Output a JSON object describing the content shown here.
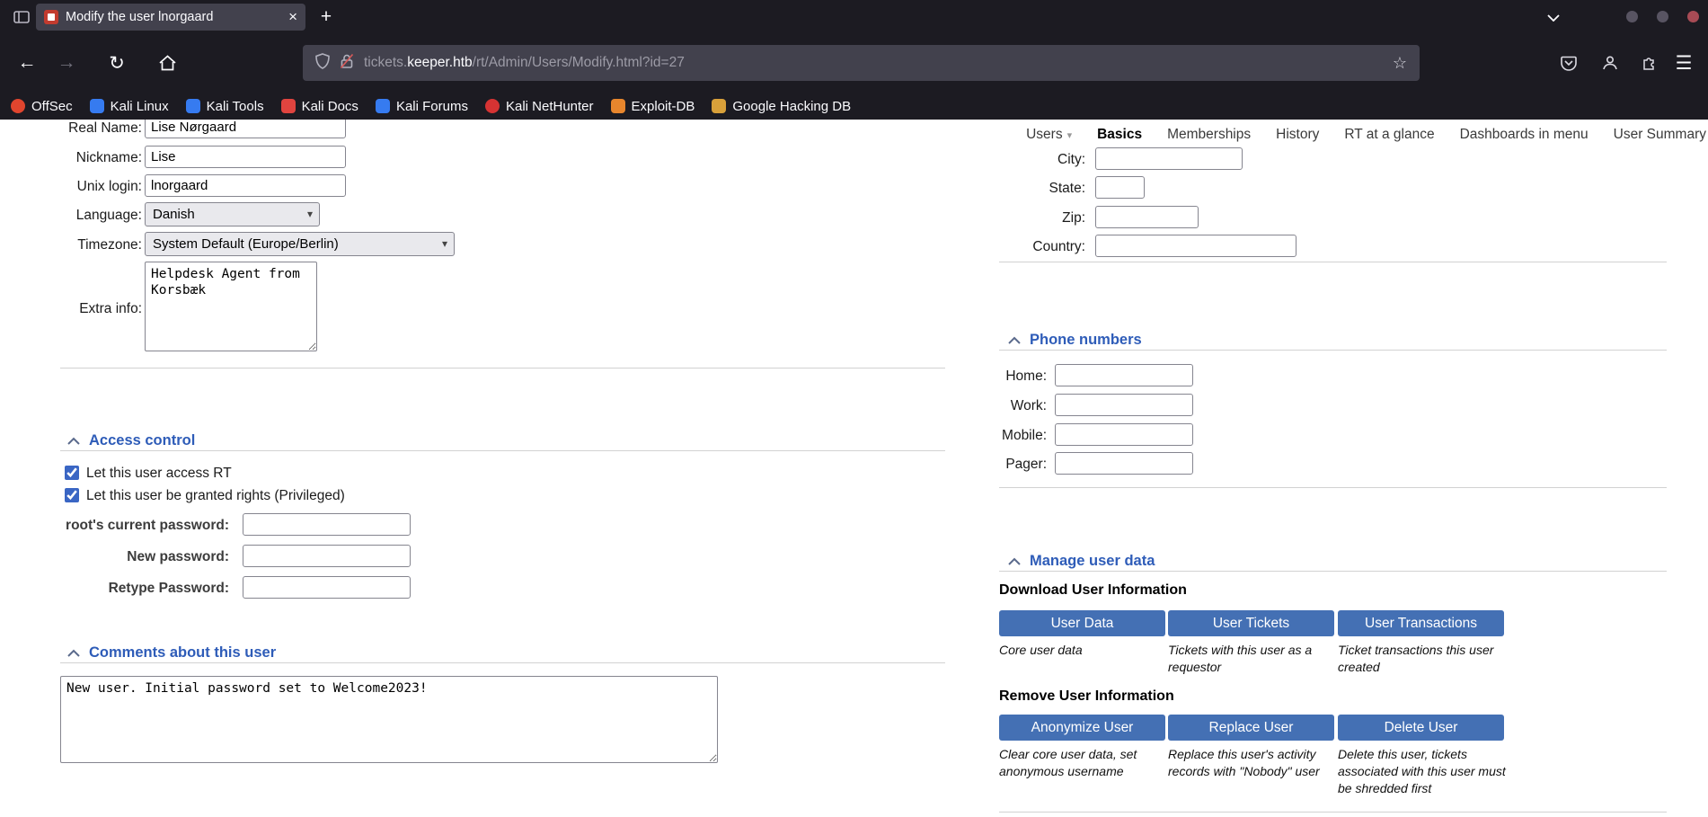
{
  "colors": {
    "chrome_bg": "#1c1b22",
    "tab_bg": "#42414d",
    "urlbar_bg": "#42414d",
    "chrome_text": "#fbfbfe",
    "page_bg": "#ffffff",
    "heading_blue": "#2e5cb8",
    "button_blue": "#4470b4",
    "button_text": "#ffffff",
    "checkbox_blue": "#3a66c4",
    "window_close_red": "#a84b55"
  },
  "browser": {
    "tab_title": "Modify the user lnorgaard",
    "tab_close_glyph": "×",
    "new_tab_glyph": "+",
    "back_glyph": "←",
    "forward_glyph": "→",
    "reload_glyph": "↻",
    "star_glyph": "☆",
    "menu_glyph": "☰",
    "url_prefix": "tickets.",
    "url_domain": "keeper.htb",
    "url_path": "/rt/Admin/Users/Modify.html?id=27",
    "bookmarks": [
      {
        "label": "OffSec",
        "color": "#e0452e"
      },
      {
        "label": "Kali Linux",
        "color": "#367bf0"
      },
      {
        "label": "Kali Tools",
        "color": "#367bf0"
      },
      {
        "label": "Kali Docs",
        "color": "#e0443f"
      },
      {
        "label": "Kali Forums",
        "color": "#367bf0"
      },
      {
        "label": "Kali NetHunter",
        "color": "#d63333"
      },
      {
        "label": "Exploit-DB",
        "color": "#e8862d"
      },
      {
        "label": "Google Hacking DB",
        "color": "#d8a03a"
      }
    ]
  },
  "page": {
    "menu": {
      "items": [
        {
          "label": "Users"
        },
        {
          "label": "Basics"
        },
        {
          "label": "Memberships"
        },
        {
          "label": "History"
        },
        {
          "label": "RT at a glance"
        },
        {
          "label": "Dashboards in menu"
        },
        {
          "label": "User Summary"
        }
      ],
      "users_caret": "▾"
    },
    "identity": {
      "real_name": {
        "label": "Real Name:",
        "value": "Lise Nørgaard"
      },
      "nickname": {
        "label": "Nickname:",
        "value": "Lise"
      },
      "unix_login": {
        "label": "Unix login:",
        "value": "lnorgaard"
      },
      "language": {
        "label": "Language:",
        "value": "Danish"
      },
      "timezone": {
        "label": "Timezone:",
        "value": "System Default (Europe/Berlin)"
      },
      "extra_info": {
        "label": "Extra info:",
        "value": "Helpdesk Agent from Korsbæk"
      }
    },
    "access_control": {
      "title": "Access control",
      "checkbox_access": "Let this user access RT",
      "checkbox_privileged": "Let this user be granted rights (Privileged)",
      "current_password_label": "root's current password:",
      "new_password_label": "New password:",
      "retype_password_label": "Retype Password:"
    },
    "comments": {
      "title": "Comments about this user",
      "value": "New user. Initial password set to Welcome2023!"
    },
    "location": {
      "city_label": "City:",
      "state_label": "State:",
      "zip_label": "Zip:",
      "country_label": "Country:"
    },
    "phones": {
      "title": "Phone numbers",
      "home_label": "Home:",
      "work_label": "Work:",
      "mobile_label": "Mobile:",
      "pager_label": "Pager:"
    },
    "manage": {
      "title": "Manage user data",
      "download_heading": "Download User Information",
      "download_actions": [
        {
          "button": "User Data",
          "desc": "Core user data"
        },
        {
          "button": "User Tickets",
          "desc": "Tickets with this user as a requestor"
        },
        {
          "button": "User Transactions",
          "desc": "Ticket transactions this user created"
        }
      ],
      "remove_heading": "Remove User Information",
      "remove_actions": [
        {
          "button": "Anonymize User",
          "desc": "Clear core user data, set anonymous username"
        },
        {
          "button": "Replace User",
          "desc": "Replace this user's activity records with \"Nobody\" user"
        },
        {
          "button": "Delete User",
          "desc": "Delete this user, tickets associated with this user must be shredded first"
        }
      ]
    }
  }
}
